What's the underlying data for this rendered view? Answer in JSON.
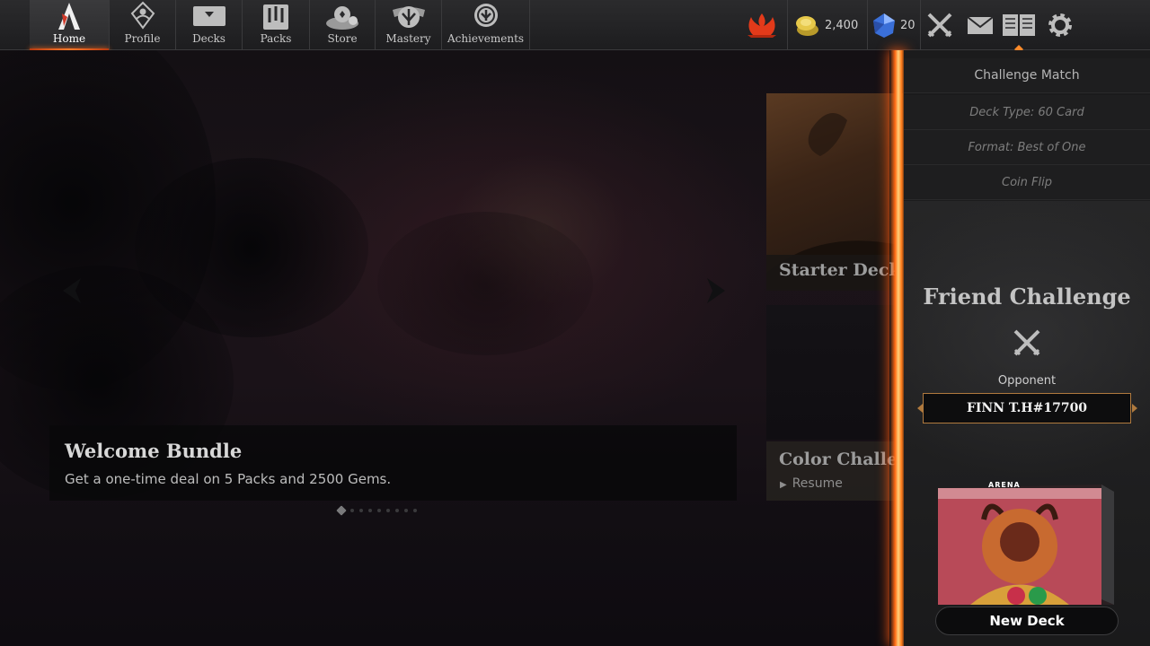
{
  "nav": {
    "items": [
      {
        "label": "Home",
        "active": true,
        "icon": "arena-logo-icon"
      },
      {
        "label": "Profile",
        "active": false,
        "icon": "profile-icon"
      },
      {
        "label": "Decks",
        "active": false,
        "icon": "decks-icon"
      },
      {
        "label": "Packs",
        "active": false,
        "icon": "packs-icon"
      },
      {
        "label": "Store",
        "active": false,
        "icon": "store-icon"
      },
      {
        "label": "Mastery",
        "active": false,
        "icon": "mastery-icon"
      },
      {
        "label": "Achievements",
        "active": false,
        "icon": "achievements-icon"
      }
    ],
    "gold": "2,400",
    "gems": "20",
    "accent": "#ff6a1a"
  },
  "carousel": {
    "title": "Welcome Bundle",
    "subtitle": "Get a one-time deal on 5 Packs and 2500 Gems.",
    "page": 1,
    "total_pages": 9
  },
  "tiles": {
    "starter": "Starter Deck",
    "color": "Color Challenge",
    "resume": "Resume"
  },
  "panel": {
    "header": "Challenge Match",
    "deck_type": "Deck Type: 60 Card",
    "format": "Format: Best of One",
    "coin_flip": "Coin Flip",
    "title": "Friend Challenge",
    "opponent_label": "Opponent",
    "opponent_value": "FINN T.H#17700",
    "deck_brand": "ARENA",
    "deck_button": "New Deck"
  }
}
